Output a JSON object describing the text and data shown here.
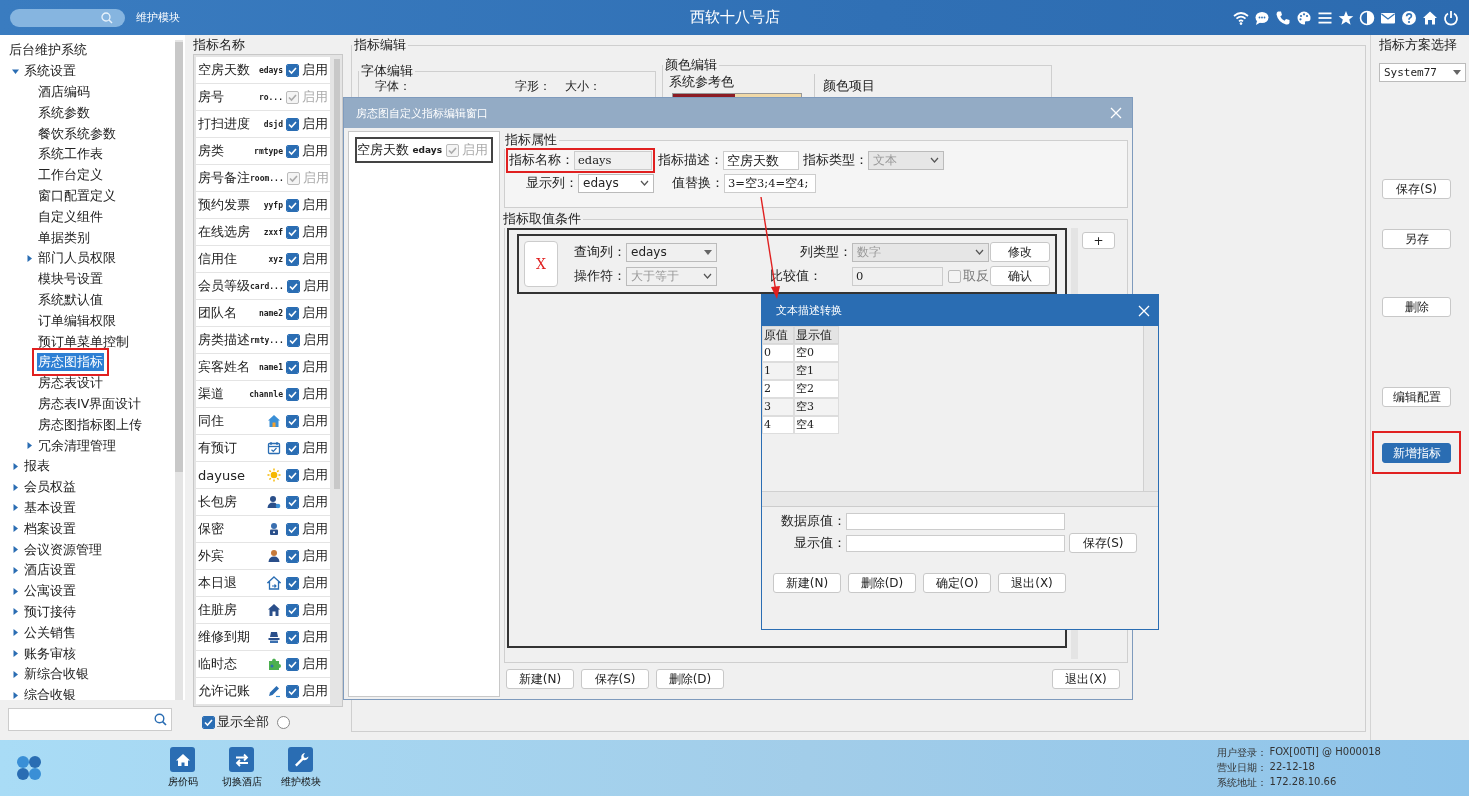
{
  "top_bar": {
    "module": "维护模块",
    "title": "西软十八号店"
  },
  "tree": {
    "label": "后台维护系统",
    "selected": false,
    "highlighted": false,
    "children": [
      {
        "label": "系统设置",
        "selected": false,
        "highlighted": false,
        "expanded": true,
        "children": [
          {
            "label": "酒店编码",
            "selected": false,
            "highlighted": false
          },
          {
            "label": "系统参数",
            "selected": false,
            "highlighted": false
          },
          {
            "label": "餐饮系统参数",
            "selected": false,
            "highlighted": false
          },
          {
            "label": "系统工作表",
            "selected": false,
            "highlighted": false
          },
          {
            "label": "工作台定义",
            "selected": false,
            "highlighted": false
          },
          {
            "label": "窗口配置定义",
            "selected": false,
            "highlighted": false
          },
          {
            "label": "自定义组件",
            "selected": false,
            "highlighted": false
          },
          {
            "label": "单据类别",
            "selected": false,
            "highlighted": false
          },
          {
            "label": "部门人员权限",
            "selected": false,
            "highlighted": false,
            "expanded": false
          },
          {
            "label": "模块号设置",
            "selected": false,
            "highlighted": false
          },
          {
            "label": "系统默认值",
            "selected": false,
            "highlighted": false
          },
          {
            "label": "订单编辑权限",
            "selected": false,
            "highlighted": false
          },
          {
            "label": "预订单菜单控制",
            "selected": false,
            "highlighted": false
          },
          {
            "label": "房态图指标",
            "selected": true,
            "highlighted": true
          },
          {
            "label": "房态表设计",
            "selected": false,
            "highlighted": false
          },
          {
            "label": "房态表IV界面设计",
            "selected": false,
            "highlighted": false
          },
          {
            "label": "房态图指标图上传",
            "selected": false,
            "highlighted": false
          },
          {
            "label": "冗余清理管理",
            "selected": false,
            "highlighted": false,
            "expanded": false
          }
        ]
      },
      {
        "label": "报表",
        "selected": false,
        "highlighted": false,
        "expanded": false
      },
      {
        "label": "会员权益",
        "selected": false,
        "highlighted": false,
        "expanded": false
      },
      {
        "label": "基本设置",
        "selected": false,
        "highlighted": false,
        "expanded": false
      },
      {
        "label": "档案设置",
        "selected": false,
        "highlighted": false,
        "expanded": false
      },
      {
        "label": "会议资源管理",
        "selected": false,
        "highlighted": false,
        "expanded": false
      },
      {
        "label": "酒店设置",
        "selected": false,
        "highlighted": false,
        "expanded": false
      },
      {
        "label": "公寓设置",
        "selected": false,
        "highlighted": false,
        "expanded": false
      },
      {
        "label": "预订接待",
        "selected": false,
        "highlighted": false,
        "expanded": false
      },
      {
        "label": "公关销售",
        "selected": false,
        "highlighted": false,
        "expanded": false
      },
      {
        "label": "账务审核",
        "selected": false,
        "highlighted": false,
        "expanded": false
      },
      {
        "label": "新综合收银",
        "selected": false,
        "highlighted": false,
        "expanded": false
      },
      {
        "label": "综合收银",
        "selected": false,
        "highlighted": false,
        "expanded": false
      }
    ]
  },
  "indicator_list": {
    "title": "指标名称",
    "rows": [
      {
        "name": "空房天数",
        "kind": "code",
        "code": "edays",
        "checked": true,
        "disabled": false,
        "label": "启用"
      },
      {
        "name": "房号",
        "kind": "code",
        "code": "ro...",
        "checked": true,
        "disabled": true,
        "label": "启用"
      },
      {
        "name": "打扫进度",
        "kind": "code",
        "code": "dsjd",
        "checked": true,
        "disabled": false,
        "label": "启用"
      },
      {
        "name": "房类",
        "kind": "code",
        "code": "rmtype",
        "checked": true,
        "disabled": false,
        "label": "启用"
      },
      {
        "name": "房号备注",
        "kind": "code",
        "code": "room...",
        "checked": true,
        "disabled": true,
        "label": "启用"
      },
      {
        "name": "预约发票",
        "kind": "code",
        "code": "yyfp",
        "checked": true,
        "disabled": false,
        "label": "启用"
      },
      {
        "name": "在线选房",
        "kind": "code",
        "code": "zxxf",
        "checked": true,
        "disabled": false,
        "label": "启用"
      },
      {
        "name": "信用住",
        "kind": "code",
        "code": "xyz",
        "checked": true,
        "disabled": false,
        "label": "启用"
      },
      {
        "name": "会员等级",
        "kind": "code",
        "code": "card...",
        "checked": true,
        "disabled": false,
        "label": "启用"
      },
      {
        "name": "团队名",
        "kind": "code",
        "code": "name2",
        "checked": true,
        "disabled": false,
        "label": "启用"
      },
      {
        "name": "房类描述",
        "kind": "code",
        "code": "rmty...",
        "checked": true,
        "disabled": false,
        "label": "启用"
      },
      {
        "name": "宾客姓名",
        "kind": "code",
        "code": "name1",
        "checked": true,
        "disabled": false,
        "label": "启用"
      },
      {
        "name": "渠道",
        "kind": "code",
        "code": "channle",
        "checked": true,
        "disabled": false,
        "label": "启用"
      },
      {
        "name": "同住",
        "kind": "icon",
        "checked": true,
        "disabled": false,
        "label": "启用"
      },
      {
        "name": "有预订",
        "kind": "icon",
        "checked": true,
        "disabled": false,
        "label": "启用"
      },
      {
        "name": "dayuse",
        "kind": "icon",
        "checked": true,
        "disabled": false,
        "label": "启用"
      },
      {
        "name": "长包房",
        "kind": "icon",
        "checked": true,
        "disabled": false,
        "label": "启用"
      },
      {
        "name": "保密",
        "kind": "icon",
        "checked": true,
        "disabled": false,
        "label": "启用"
      },
      {
        "name": "外宾",
        "kind": "icon",
        "checked": true,
        "disabled": false,
        "label": "启用"
      },
      {
        "name": "本日退",
        "kind": "icon",
        "checked": true,
        "disabled": false,
        "label": "启用"
      },
      {
        "name": "住脏房",
        "kind": "icon",
        "checked": true,
        "disabled": false,
        "label": "启用"
      },
      {
        "name": "维修到期",
        "kind": "icon",
        "checked": true,
        "disabled": false,
        "label": "启用"
      },
      {
        "name": "临时态",
        "kind": "icon",
        "checked": true,
        "disabled": false,
        "label": "启用"
      },
      {
        "name": "允许记账",
        "kind": "icon",
        "checked": true,
        "disabled": false,
        "label": "启用"
      }
    ],
    "show_all": {
      "label": "显示全部",
      "checked": true
    },
    "option": {
      "selected": false
    }
  },
  "editor": {
    "title": "指标编辑",
    "font_group": {
      "title": "字体编辑",
      "labels": [
        "字体：",
        "字形：",
        "大小："
      ]
    },
    "color_group": {
      "title": "颜色编辑",
      "reference_title": "系统参考色",
      "items_title": "颜色项目"
    }
  },
  "right_panel": {
    "title": "指标方案选择",
    "scheme": "System77",
    "buttons": [
      {
        "label": "保存(S)",
        "primary": false,
        "highlighted": false
      },
      {
        "label": "另存",
        "primary": false,
        "highlighted": false
      },
      {
        "label": "删除",
        "primary": false,
        "highlighted": false
      },
      {
        "label": "编辑配置",
        "primary": false,
        "highlighted": false
      },
      {
        "label": "新增指标",
        "primary": true,
        "highlighted": true
      }
    ]
  },
  "dialog": {
    "title": "房态图自定义指标编辑窗口",
    "list_item": {
      "name": "空房天数",
      "code": "edays",
      "checked": true,
      "disabled": true,
      "label": "启用"
    },
    "props": {
      "title": "指标属性",
      "name_label": "指标名称：",
      "name_value": "edays",
      "name_highlighted": true,
      "desc_label": "指标描述：",
      "desc_value": "空房天数",
      "type_label": "指标类型：",
      "type_value": "文本",
      "column_label": "显示列：",
      "column_value": "edays",
      "replace_label": "值替换：",
      "replace_value": "3=空3;4=空4;"
    },
    "conditions": {
      "title": "指标取值条件",
      "remove": "X",
      "query_label": "查询列：",
      "query_value": "edays",
      "coltype_label": "列类型：",
      "coltype_value": "数字",
      "modify": "修改",
      "op_label": "操作符：",
      "op_value": "大于等于",
      "cmp_label": "比较值：",
      "cmp_value": "0",
      "negate": {
        "label": "取反",
        "checked": false
      },
      "confirm": "确认",
      "add": "+"
    },
    "buttons": [
      "新建(N)",
      "保存(S)",
      "删除(D)"
    ],
    "exit": "退出(X)"
  },
  "text_dialog": {
    "title": "文本描述转换",
    "columns": [
      "原值",
      "显示值"
    ],
    "rows": [
      [
        "0",
        "空0"
      ],
      [
        "1",
        "空1"
      ],
      [
        "2",
        "空2"
      ],
      [
        "3",
        "空3"
      ],
      [
        "4",
        "空4"
      ]
    ],
    "raw_label": "数据原值：",
    "display_label": "显示值：",
    "save": "保存(S)",
    "buttons": [
      "新建(N)",
      "删除(D)",
      "确定(O)",
      "退出(X)"
    ]
  },
  "bottom_bar": {
    "shortcuts": [
      "房价码",
      "切换酒店",
      "维护模块"
    ],
    "info": [
      {
        "label": "用户登录：",
        "value": "FOX[00TI] @ H000018"
      },
      {
        "label": "营业日期：",
        "value": "22-12-18"
      },
      {
        "label": "系统地址：",
        "value": "172.28.10.66"
      }
    ]
  }
}
